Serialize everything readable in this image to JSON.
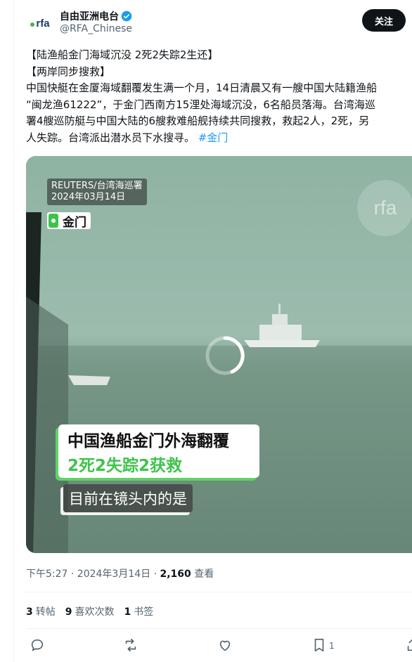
{
  "account": {
    "avatar_text": "rfa",
    "display_name": "自由亚洲电台",
    "handle": "@RFA_Chinese",
    "follow_label": "关注"
  },
  "tweet": {
    "lines": [
      "【陆渔船金门海域沉没 2死2失踪2生还】",
      "【两岸同步搜救】",
      "中国快艇在金厦海域翻覆发生满一个月，14日清晨又有一艘中国大陆籍渔船",
      "“闽龙渔61222”，于金门西南方15浬处海域沉没，6名船员落海。台湾海巡",
      "署4艘巡防艇与中国大陆的6艘救难船舰持续共同搜救，救起2人，2死，另",
      "人失踪。台湾派出潜水员下水搜寻。"
    ],
    "hashtag": "#金门"
  },
  "media": {
    "credit_line1": "REUTERS/台湾海巡署",
    "credit_line2": "2024年03月14日",
    "location": "金门",
    "watermark": "rfa",
    "headline1": "中国渔船金门外海翻覆",
    "headline2": "2死2失踪2获救",
    "subtitle": "目前在镜头内的是"
  },
  "meta": {
    "time_date": "下午5:27 · 2024年3月14日 · ",
    "views_count": "2,160",
    "views_label": " 查看"
  },
  "stats": {
    "retweets_count": "3",
    "retweets_label": "转帖",
    "likes_count": "9",
    "likes_label": "喜欢次数",
    "bookmarks_count": "1",
    "bookmarks_label": "书签"
  },
  "actions": {
    "bookmark_count": "1"
  },
  "colors": {
    "accent": "#1d9bf0",
    "headline_green": "#3ec44c",
    "text_primary": "#0f1419",
    "text_secondary": "#536471"
  }
}
